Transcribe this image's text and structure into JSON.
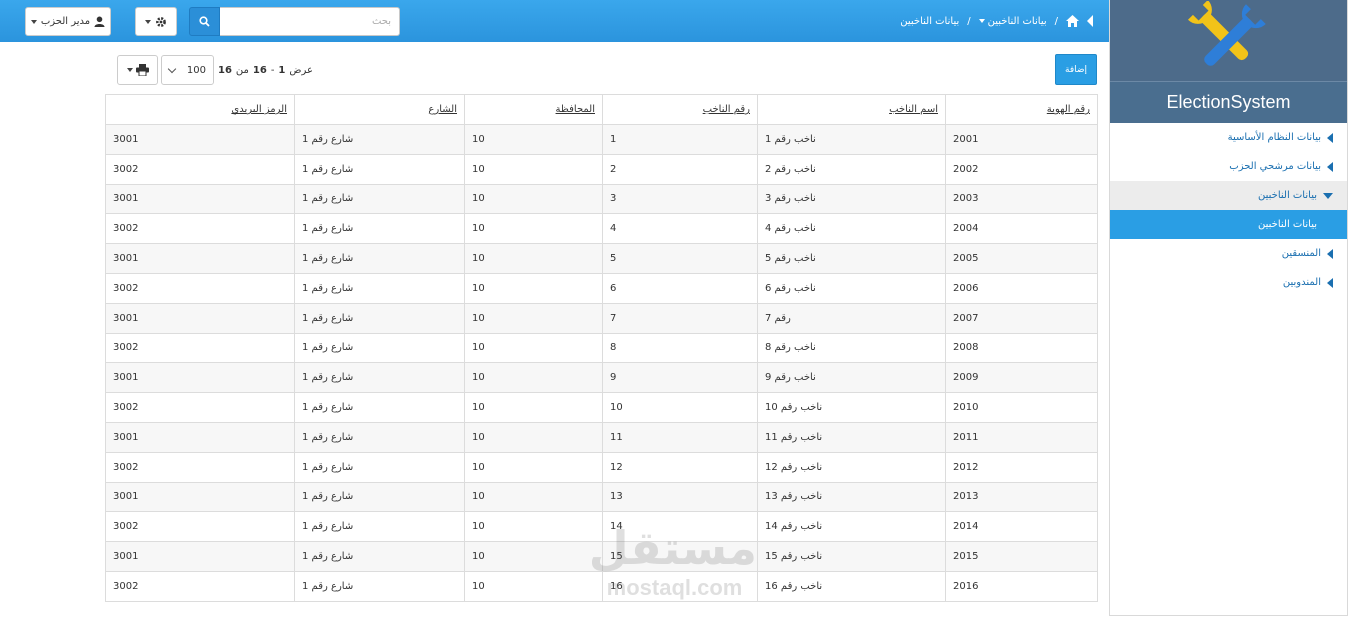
{
  "sidebar": {
    "brand_title": "ElectionSystem",
    "items": [
      {
        "label": "بيانات النظام الأساسية",
        "state": "collapsed"
      },
      {
        "label": "بيانات مرشحي الحزب",
        "state": "collapsed"
      },
      {
        "label": "بيانات الناخبين",
        "state": "expanded"
      },
      {
        "label": "بيانات الناخبين",
        "state": "active"
      },
      {
        "label": "المنسقين",
        "state": "collapsed"
      },
      {
        "label": "المندوبين",
        "state": "collapsed"
      }
    ]
  },
  "topbar": {
    "breadcrumb_section": "بيانات الناخبين",
    "breadcrumb_separator": "/",
    "breadcrumb_current": "بيانات الناخبين",
    "search_placeholder": "بحث",
    "user_menu_label": "مدير الحزب"
  },
  "toolbar": {
    "add_label": "إضافة",
    "page_info": {
      "prefix": "عرض",
      "from": "1",
      "dash": "-",
      "to": "16",
      "of": "من",
      "total": "16"
    },
    "page_size": "100"
  },
  "table": {
    "headers": [
      "رقم الهوية",
      "اسم الناخب",
      "رقم الناخب",
      "المحافظة",
      "الشارع",
      "الرمز البريدي"
    ],
    "rows": [
      [
        "2001",
        "ناخب رقم 1",
        "1",
        "10",
        "شارع رقم 1",
        "3001"
      ],
      [
        "2002",
        "ناخب رقم 2",
        "2",
        "10",
        "شارع رقم 1",
        "3002"
      ],
      [
        "2003",
        "ناخب رقم 3",
        "3",
        "10",
        "شارع رقم 1",
        "3001"
      ],
      [
        "2004",
        "ناخب رقم 4",
        "4",
        "10",
        "شارع رقم 1",
        "3002"
      ],
      [
        "2005",
        "ناخب رقم 5",
        "5",
        "10",
        "شارع رقم 1",
        "3001"
      ],
      [
        "2006",
        "ناخب رقم 6",
        "6",
        "10",
        "شارع رقم 1",
        "3002"
      ],
      [
        "2007",
        "رقم 7",
        "7",
        "10",
        "شارع رقم 1",
        "3001"
      ],
      [
        "2008",
        "ناخب رقم 8",
        "8",
        "10",
        "شارع رقم 1",
        "3002"
      ],
      [
        "2009",
        "ناخب رقم 9",
        "9",
        "10",
        "شارع رقم 1",
        "3001"
      ],
      [
        "2010",
        "ناخب رقم 10",
        "10",
        "10",
        "شارع رقم 1",
        "3002"
      ],
      [
        "2011",
        "ناخب رقم 11",
        "11",
        "10",
        "شارع رقم 1",
        "3001"
      ],
      [
        "2012",
        "ناخب رقم 12",
        "12",
        "10",
        "شارع رقم 1",
        "3002"
      ],
      [
        "2013",
        "ناخب رقم 13",
        "13",
        "10",
        "شارع رقم 1",
        "3001"
      ],
      [
        "2014",
        "ناخب رقم 14",
        "14",
        "10",
        "شارع رقم 1",
        "3002"
      ],
      [
        "2015",
        "ناخب رقم 15",
        "15",
        "10",
        "شارع رقم 1",
        "3001"
      ],
      [
        "2016",
        "ناخب رقم 16",
        "16",
        "10",
        "شارع رقم 1",
        "3002"
      ]
    ]
  },
  "watermark": {
    "arabic": "مستقل",
    "latin": "mostaql.com"
  },
  "colors": {
    "accent": "#2a9ee4",
    "sidebar_brand": "#4d6b8a",
    "link": "#1a6fb0"
  }
}
